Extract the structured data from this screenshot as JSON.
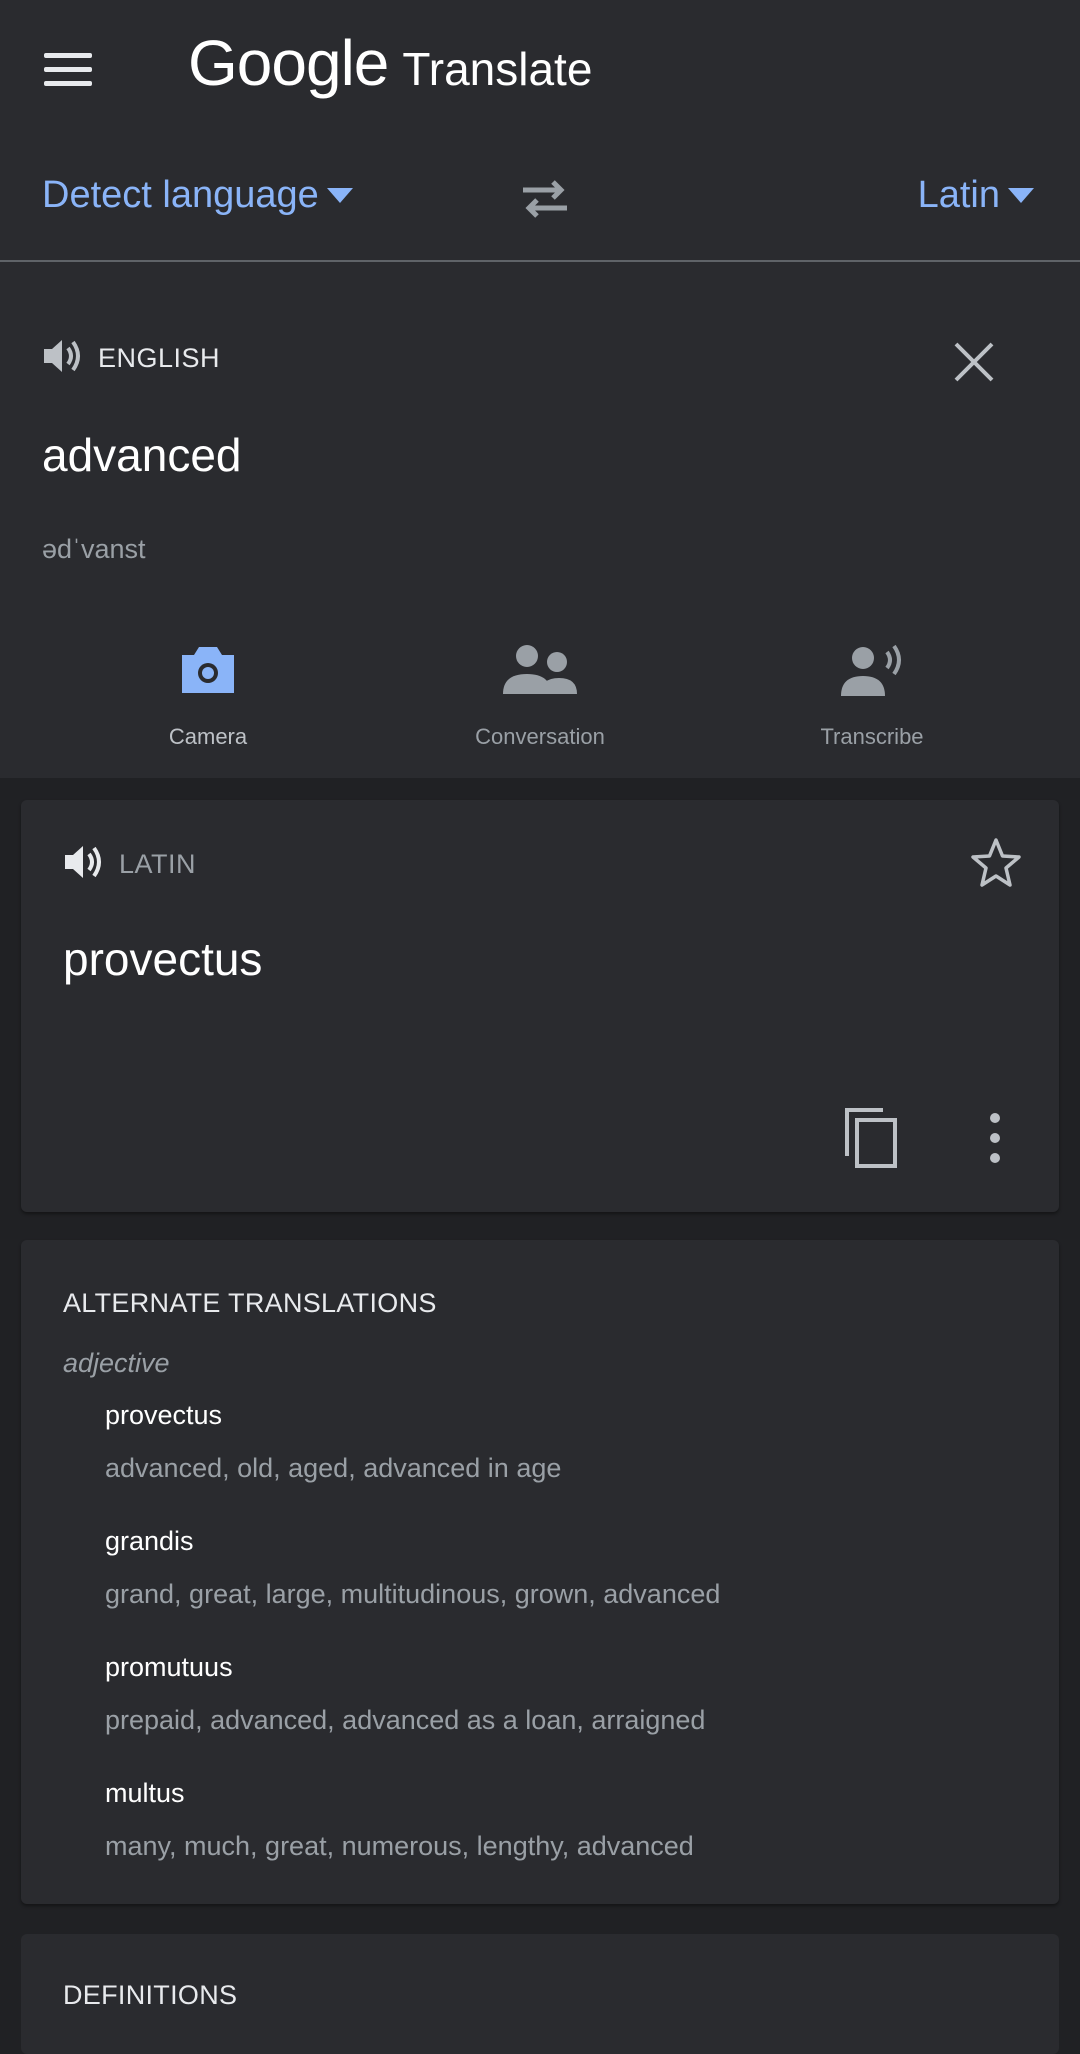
{
  "header": {
    "brand_google": "Google",
    "brand_product": "Translate"
  },
  "language_bar": {
    "source": "Detect language",
    "target": "Latin"
  },
  "input": {
    "detected_label": "ENGLISH",
    "text": "advanced",
    "phonetic": "ədˈvanst"
  },
  "tools": [
    {
      "label": "Camera",
      "icon": "camera-icon"
    },
    {
      "label": "Conversation",
      "icon": "conversation-icon"
    },
    {
      "label": "Transcribe",
      "icon": "transcribe-icon"
    }
  ],
  "result": {
    "lang_label": "LATIN",
    "text": "provectus"
  },
  "alternate_translations": {
    "title": "ALTERNATE TRANSLATIONS",
    "part_of_speech": "adjective",
    "items": [
      {
        "word": "provectus",
        "meanings": "advanced, old, aged, advanced in age"
      },
      {
        "word": "grandis",
        "meanings": "grand, great, large, multitudinous, grown, advanced"
      },
      {
        "word": "promutuus",
        "meanings": "prepaid, advanced, advanced as a loan, arraigned"
      },
      {
        "word": "multus",
        "meanings": "many, much, great, numerous, lengthy, advanced"
      }
    ]
  },
  "definitions": {
    "title": "DEFINITIONS"
  },
  "colors": {
    "accent": "#8ab4f8",
    "background": "#202124",
    "surface": "#2a2b2f",
    "camera_icon": "#8ab4f8"
  }
}
